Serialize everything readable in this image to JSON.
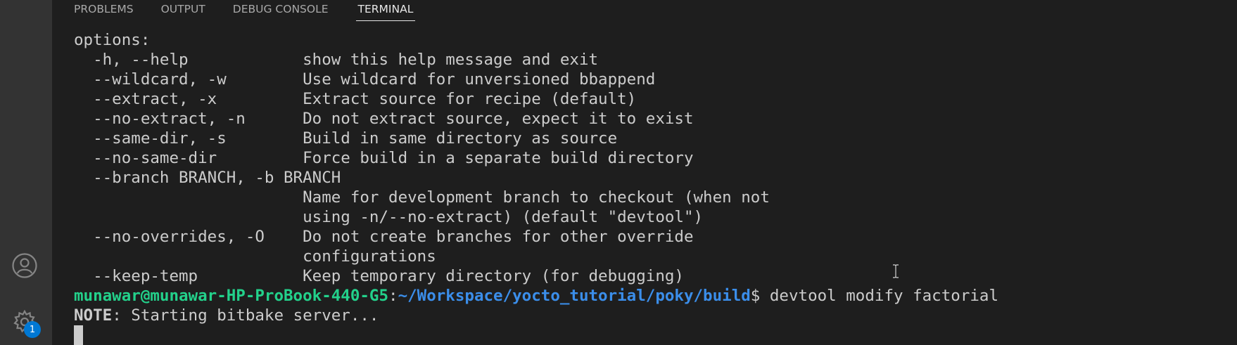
{
  "colors": {
    "background": "#1e1e1e",
    "activity_bar": "#333333",
    "prompt_user": "#23d18b",
    "prompt_path": "#3b8eea",
    "text": "#cccccc",
    "badge": "#0078d4"
  },
  "activity_bar": {
    "account_icon": "account-icon",
    "settings_icon": "gear-icon",
    "settings_badge": "1"
  },
  "panel": {
    "tabs": [
      {
        "label": "PROBLEMS",
        "active": false
      },
      {
        "label": "OUTPUT",
        "active": false
      },
      {
        "label": "DEBUG CONSOLE",
        "active": false
      },
      {
        "label": "TERMINAL",
        "active": true
      }
    ]
  },
  "terminal": {
    "lines": [
      "options:",
      "  -h, --help            show this help message and exit",
      "  --wildcard, -w        Use wildcard for unversioned bbappend",
      "  --extract, -x         Extract source for recipe (default)",
      "  --no-extract, -n      Do not extract source, expect it to exist",
      "  --same-dir, -s        Build in same directory as source",
      "  --no-same-dir         Force build in a separate build directory",
      "  --branch BRANCH, -b BRANCH",
      "                        Name for development branch to checkout (when not",
      "                        using -n/--no-extract) (default \"devtool\")",
      "  --no-overrides, -O    Do not create branches for other override",
      "                        configurations",
      "  --keep-temp           Keep temporary directory (for debugging)"
    ],
    "prompt": {
      "user_host": "munawar@munawar-HP-ProBook-440-G5",
      "colon": ":",
      "path": "~/Workspace/yocto_tutorial/poky/build",
      "dollar": "$",
      "command": " devtool modify factorial"
    },
    "note": {
      "label": "NOTE",
      "message": ": Starting bitbake server..."
    }
  }
}
